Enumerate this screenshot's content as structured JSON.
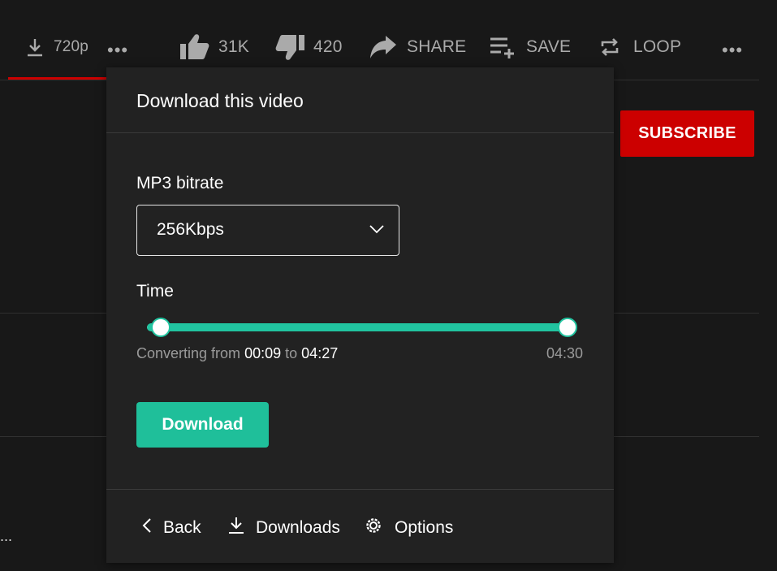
{
  "toolbar": {
    "download_quality": "720p",
    "more_dots": "•••",
    "like_count": "31K",
    "dislike_count": "420",
    "share_label": "SHARE",
    "save_label": "SAVE",
    "loop_label": "LOOP",
    "overflow_dots": "•••"
  },
  "subscribe_label": "SUBSCRIBE",
  "truncated_text": "...",
  "popup": {
    "title": "Download this video",
    "bitrate_label": "MP3 bitrate",
    "bitrate_value": "256Kbps",
    "time_label": "Time",
    "converting_prefix": "Converting from",
    "start_time": "00:09",
    "to_word": "to",
    "end_time": "04:27",
    "duration": "04:30",
    "download_button": "Download",
    "footer": {
      "back": "Back",
      "downloads": "Downloads",
      "options": "Options"
    }
  },
  "colors": {
    "accent": "#1fbf9a",
    "subscribe": "#cc0000",
    "background": "#181818",
    "popup": "#222222"
  },
  "icons": [
    "download-icon",
    "thumbs-up-icon",
    "thumbs-down-icon",
    "share-icon",
    "playlist-add-icon",
    "loop-icon",
    "chevron-down-icon",
    "chevron-left-icon",
    "gear-icon"
  ]
}
